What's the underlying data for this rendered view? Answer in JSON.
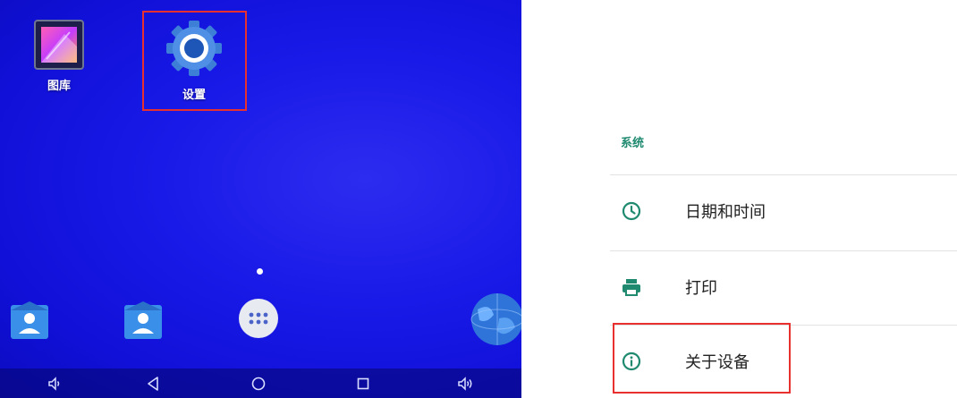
{
  "home": {
    "apps": [
      {
        "label": "图库",
        "icon": "gallery-icon"
      },
      {
        "label": "设置",
        "icon": "gear-icon"
      }
    ],
    "dock": [
      "contacts-icon",
      "contacts-icon",
      "app-drawer-icon",
      "browser-globe-icon"
    ],
    "navbar": [
      "volume-down-icon",
      "back-icon",
      "home-icon",
      "recents-icon",
      "volume-up-icon"
    ]
  },
  "settings": {
    "section_title": "系统",
    "items": [
      {
        "label": "日期和时间",
        "icon": "clock-icon"
      },
      {
        "label": "打印",
        "icon": "print-icon"
      },
      {
        "label": "关于设备",
        "icon": "info-icon"
      }
    ]
  },
  "colors": {
    "highlight": "#e8302f",
    "accent": "#1f8a70",
    "wallpaper": "#1a1ae8"
  }
}
